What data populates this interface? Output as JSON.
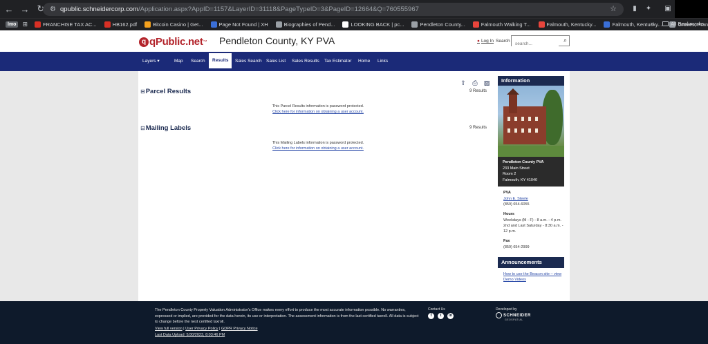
{
  "browser": {
    "url_host": "qpublic.schneidercorp.com",
    "url_path": "/Application.aspx?AppID=1157&LayerID=31118&PageTypeID=3&PageID=12664&Q=760555967",
    "bookmarks": [
      {
        "label": "FRANCHISE TAX AC...",
        "color": "#d93025"
      },
      {
        "label": "HB162.pdf",
        "color": "#d93025"
      },
      {
        "label": "Bitcoin Casino | Get...",
        "color": "#f4a11d"
      },
      {
        "label": "Page Not Found | XH",
        "color": "#3a6fd8"
      },
      {
        "label": "Biographies of Pend...",
        "color": "#9aa0a6"
      },
      {
        "label": "LOOKING BACK | pc...",
        "color": "#ffffff"
      },
      {
        "label": "Pendleton County...",
        "color": "#9aa0a6"
      },
      {
        "label": "Falmouth Walking T...",
        "color": "#e8453c"
      },
      {
        "label": "Falmouth, Kentucky...",
        "color": "#e8453c"
      },
      {
        "label": "Falmouth, Kentucky...",
        "color": "#3a6fd8"
      },
      {
        "label": "Graves, Frank · Afric...",
        "color": "#9aa0a6"
      }
    ],
    "first_tab": "lmo",
    "all_bookmarks": "All Bookmarks"
  },
  "header": {
    "logo_text": "qPublic.net",
    "logo_tm": "™",
    "county_title": "Pendleton County, KY PVA",
    "login": "Log In",
    "search_label": "Search",
    "search_placeholder": "search..."
  },
  "nav": {
    "items": [
      {
        "label": "Layers ▾"
      },
      {
        "label": "Map"
      },
      {
        "label": "Search"
      },
      {
        "label": "Results"
      },
      {
        "label": "Sales Search"
      },
      {
        "label": "Sales List"
      },
      {
        "label": "Sales Results"
      },
      {
        "label": "Tax Estimator"
      },
      {
        "label": "Home"
      },
      {
        "label": "Links"
      }
    ]
  },
  "main": {
    "parcel": {
      "title": "Parcel Results",
      "count": "9 Results",
      "protected": "This Parcel Results information is password protected.",
      "link": "Click here for information on obtaining a user account."
    },
    "mailing": {
      "title": "Mailing Labels",
      "count": "9 Results",
      "protected": "This Mailing Labels information is password protected.",
      "link": "Click here for information on obtaining a user account."
    }
  },
  "sidebar": {
    "info_title": "Information",
    "office_name": "Pendleton County PVA",
    "address1": "233 Main Street",
    "address2": "Room 2",
    "address3": "Falmouth, KY 41040",
    "pva_label": "PVA",
    "pva_name": "John E. Steele",
    "pva_phone": "(859) 654-6055",
    "hours_label": "Hours",
    "hours_text": "Weekdays (M - F) - 8 a.m. - 4 p.m. 2nd and Last Saturday - 8:30 a.m. - 12 p.m.",
    "fax_label": "Fax",
    "fax_phone": "(859) 654-2999",
    "announce_title": "Announcements",
    "announce_link": "How to use the Beacon site – view Demo Videos"
  },
  "footer": {
    "disclaimer": "The Pendleton County Property Valuation Administrator's Office makes every effort to produce the most accurate information possible. No warranties, expressed or implied, are provided for the data herein, its use or interpretation. The assessment information is from the last certified taxroll. All data is subject to change before the next certified taxroll.",
    "link_full": "View full version",
    "link_privacy": "User Privacy Policy",
    "link_gdpr": "GDPR Privacy Notice",
    "sep": "|",
    "last_upload": "Last Data Upload: 5/30/2023, 8:03:46 PM",
    "contact_us": "Contact Us",
    "developed_by": "Developed by",
    "schneider": "SCHNEIDER",
    "schneider_sub": "GEOSPATIAL"
  }
}
